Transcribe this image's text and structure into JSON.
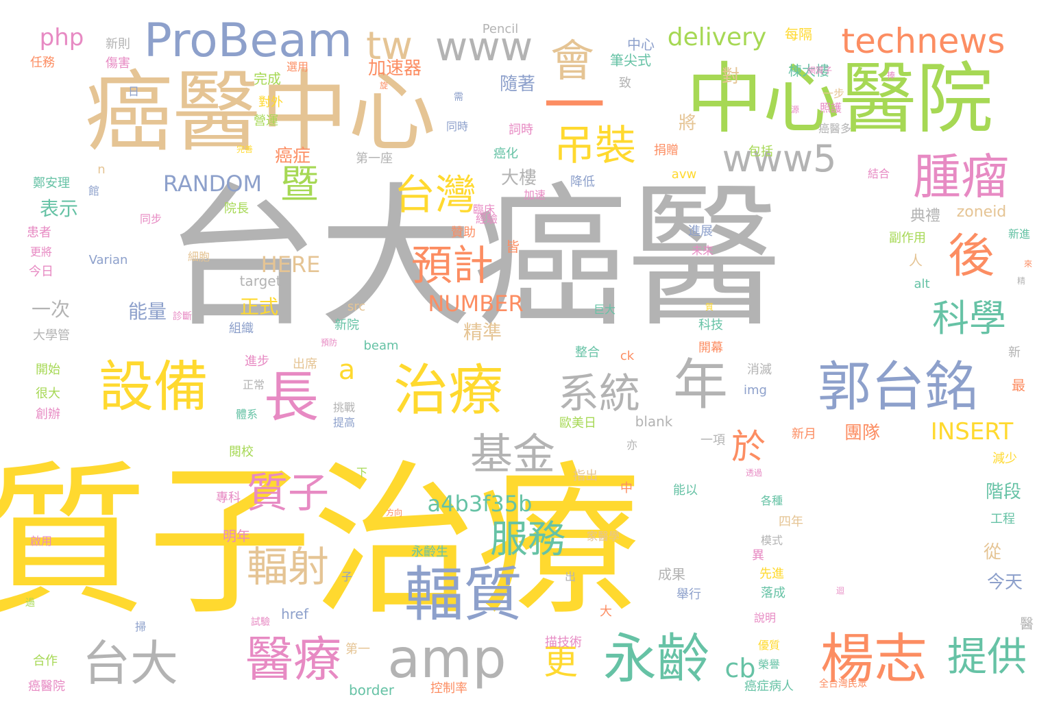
{
  "palette": {
    "gray": "#b3b3b3",
    "yellow": "#ffd92f",
    "tan": "#e5c494",
    "green": "#a6d854",
    "blue": "#8da0cb",
    "pink": "#e78ac3",
    "orange": "#fc8d62",
    "teal": "#66c2a5"
  },
  "words": [
    {
      "text": "質子治療",
      "color": "yellow"
    },
    {
      "text": "台大癌醫",
      "color": "gray"
    },
    {
      "text": "癌醫中心",
      "color": "tan"
    },
    {
      "text": "中心醫院",
      "color": "green"
    },
    {
      "text": "一",
      "color": "orange"
    },
    {
      "text": "ProBeam",
      "color": "blue"
    },
    {
      "text": "tw",
      "color": "tan"
    },
    {
      "text": "www",
      "color": "gray"
    },
    {
      "text": "會",
      "color": "tan"
    },
    {
      "text": "technews",
      "color": "orange"
    },
    {
      "text": "php",
      "color": "pink"
    },
    {
      "text": "delivery",
      "color": "green"
    },
    {
      "text": "吊裝",
      "color": "yellow"
    },
    {
      "text": "www5",
      "color": "gray"
    },
    {
      "text": "腫瘤",
      "color": "pink"
    },
    {
      "text": "台灣",
      "color": "yellow"
    },
    {
      "text": "暨",
      "color": "green"
    },
    {
      "text": "後",
      "color": "orange"
    },
    {
      "text": "預計",
      "color": "orange"
    },
    {
      "text": "科學",
      "color": "teal"
    },
    {
      "text": "設備",
      "color": "yellow"
    },
    {
      "text": "治療",
      "color": "yellow"
    },
    {
      "text": "長",
      "color": "pink"
    },
    {
      "text": "系統",
      "color": "gray"
    },
    {
      "text": "年",
      "color": "gray"
    },
    {
      "text": "郭台銘",
      "color": "blue"
    },
    {
      "text": "a",
      "color": "yellow"
    },
    {
      "text": "基金",
      "color": "gray"
    },
    {
      "text": "於",
      "color": "orange"
    },
    {
      "text": "質子",
      "color": "pink"
    },
    {
      "text": "輻射",
      "color": "tan"
    },
    {
      "text": "服務",
      "color": "teal"
    },
    {
      "text": "輻質",
      "color": "blue"
    },
    {
      "text": "a4b3f35b",
      "color": "teal"
    },
    {
      "text": "INSERT",
      "color": "yellow"
    },
    {
      "text": "台大",
      "color": "gray"
    },
    {
      "text": "醫療",
      "color": "pink"
    },
    {
      "text": "amp",
      "color": "gray"
    },
    {
      "text": "更",
      "color": "yellow"
    },
    {
      "text": "永齡",
      "color": "teal"
    },
    {
      "text": "楊志",
      "color": "orange"
    },
    {
      "text": "提供",
      "color": "teal"
    },
    {
      "text": "cb",
      "color": "teal"
    },
    {
      "text": "RANDOM",
      "color": "blue"
    },
    {
      "text": "HERE",
      "color": "tan"
    },
    {
      "text": "NUMBER",
      "color": "orange"
    },
    {
      "text": "加速器",
      "color": "orange"
    },
    {
      "text": "隨著",
      "color": "blue"
    },
    {
      "text": "大樓",
      "color": "gray"
    },
    {
      "text": "癌症",
      "color": "orange"
    },
    {
      "text": "將",
      "color": "tan"
    },
    {
      "text": "對",
      "color": "tan"
    },
    {
      "text": "表示",
      "color": "teal"
    },
    {
      "text": "一次",
      "color": "gray"
    },
    {
      "text": "能量",
      "color": "blue"
    },
    {
      "text": "正式",
      "color": "yellow"
    },
    {
      "text": "精準",
      "color": "tan"
    },
    {
      "text": "團隊",
      "color": "orange"
    },
    {
      "text": "階段",
      "color": "teal"
    },
    {
      "text": "今天",
      "color": "blue"
    },
    {
      "text": "從",
      "color": "tan"
    },
    {
      "text": "zoneid",
      "color": "tan"
    },
    {
      "text": "典禮",
      "color": "gray"
    },
    {
      "text": "Pencil",
      "color": "gray"
    },
    {
      "text": "每隔",
      "color": "yellow"
    },
    {
      "text": "新則",
      "color": "gray"
    },
    {
      "text": "任務",
      "color": "orange"
    },
    {
      "text": "傷害",
      "color": "pink"
    },
    {
      "text": "完成",
      "color": "green"
    },
    {
      "text": "對外",
      "color": "yellow"
    },
    {
      "text": "營運",
      "color": "green"
    },
    {
      "text": "筆尖式",
      "color": "teal"
    },
    {
      "text": "中心",
      "color": "blue"
    },
    {
      "text": "棟大樓",
      "color": "teal"
    },
    {
      "text": "照護",
      "color": "pink"
    },
    {
      "text": "癌醫多",
      "color": "gray"
    },
    {
      "text": "包括",
      "color": "green"
    },
    {
      "text": "捐贈",
      "color": "orange"
    },
    {
      "text": "同時",
      "color": "blue"
    },
    {
      "text": "詞時",
      "color": "pink"
    },
    {
      "text": "癌化",
      "color": "teal"
    },
    {
      "text": "第一座",
      "color": "gray"
    },
    {
      "text": "鄭安理",
      "color": "teal"
    },
    {
      "text": "院長",
      "color": "green"
    },
    {
      "text": "同步",
      "color": "pink"
    },
    {
      "text": "患者",
      "color": "pink"
    },
    {
      "text": "更將",
      "color": "pink"
    },
    {
      "text": "今日",
      "color": "pink"
    },
    {
      "text": "Varian",
      "color": "blue"
    },
    {
      "text": "細胞",
      "color": "tan"
    },
    {
      "text": "target",
      "color": "gray"
    },
    {
      "text": "src",
      "color": "tan"
    },
    {
      "text": "大學管",
      "color": "gray"
    },
    {
      "text": "組織",
      "color": "blue"
    },
    {
      "text": "新院",
      "color": "teal"
    },
    {
      "text": "beam",
      "color": "teal"
    },
    {
      "text": "開始",
      "color": "green"
    },
    {
      "text": "很大",
      "color": "green"
    },
    {
      "text": "創辦",
      "color": "pink"
    },
    {
      "text": "進步",
      "color": "pink"
    },
    {
      "text": "出席",
      "color": "tan"
    },
    {
      "text": "正常",
      "color": "gray"
    },
    {
      "text": "挑戰",
      "color": "gray"
    },
    {
      "text": "提高",
      "color": "blue"
    },
    {
      "text": "體系",
      "color": "teal"
    },
    {
      "text": "閱校",
      "color": "green"
    },
    {
      "text": "整合",
      "color": "teal"
    },
    {
      "text": "ck",
      "color": "orange"
    },
    {
      "text": "科技",
      "color": "teal"
    },
    {
      "text": "開幕",
      "color": "orange"
    },
    {
      "text": "消滅",
      "color": "gray"
    },
    {
      "text": "img",
      "color": "blue"
    },
    {
      "text": "blank",
      "color": "gray"
    },
    {
      "text": "歐美日",
      "color": "green"
    },
    {
      "text": "一項",
      "color": "gray"
    },
    {
      "text": "新月",
      "color": "orange"
    },
    {
      "text": "專科",
      "color": "pink"
    },
    {
      "text": "明年",
      "color": "pink"
    },
    {
      "text": "永齡生",
      "color": "teal"
    },
    {
      "text": "指出",
      "color": "tan"
    },
    {
      "text": "能以",
      "color": "teal"
    },
    {
      "text": "四年",
      "color": "tan"
    },
    {
      "text": "家醫學",
      "color": "tan"
    },
    {
      "text": "模式",
      "color": "gray"
    },
    {
      "text": "工程",
      "color": "teal"
    },
    {
      "text": "成果",
      "color": "gray"
    },
    {
      "text": "先進",
      "color": "yellow"
    },
    {
      "text": "落成",
      "color": "teal"
    },
    {
      "text": "舉行",
      "color": "blue"
    },
    {
      "text": "啟用",
      "color": "pink"
    },
    {
      "text": "href",
      "color": "blue"
    },
    {
      "text": "說明",
      "color": "pink"
    },
    {
      "text": "描技術",
      "color": "pink"
    },
    {
      "text": "第一",
      "color": "tan"
    },
    {
      "text": "合作",
      "color": "green"
    },
    {
      "text": "榮譽",
      "color": "teal"
    },
    {
      "text": "優質",
      "color": "yellow"
    },
    {
      "text": "癌醫院",
      "color": "pink"
    },
    {
      "text": "border",
      "color": "teal"
    },
    {
      "text": "控制率",
      "color": "orange"
    },
    {
      "text": "癌症病人",
      "color": "teal"
    },
    {
      "text": "全台灣民眾",
      "color": "orange"
    },
    {
      "text": "減少",
      "color": "yellow"
    },
    {
      "text": "副作用",
      "color": "green"
    },
    {
      "text": "新進",
      "color": "teal"
    },
    {
      "text": "alt",
      "color": "teal"
    },
    {
      "text": "avw",
      "color": "yellow"
    },
    {
      "text": "進展",
      "color": "blue"
    },
    {
      "text": "未來",
      "color": "pink"
    },
    {
      "text": "降低",
      "color": "blue"
    },
    {
      "text": "加速",
      "color": "pink"
    },
    {
      "text": "臨床",
      "color": "pink"
    },
    {
      "text": "經驗",
      "color": "pink"
    },
    {
      "text": "贊助",
      "color": "orange"
    },
    {
      "text": "皆",
      "color": "orange"
    },
    {
      "text": "人",
      "color": "tan"
    },
    {
      "text": "巨大",
      "color": "teal"
    },
    {
      "text": "診斷",
      "color": "pink"
    },
    {
      "text": "最",
      "color": "orange"
    },
    {
      "text": "新",
      "color": "gray"
    },
    {
      "text": "醫",
      "color": "gray"
    },
    {
      "text": "中",
      "color": "orange"
    },
    {
      "text": "大",
      "color": "orange"
    },
    {
      "text": "亦",
      "color": "gray"
    },
    {
      "text": "異",
      "color": "pink"
    },
    {
      "text": "致",
      "color": "gray"
    },
    {
      "text": "結合",
      "color": "pink"
    },
    {
      "text": "館",
      "color": "blue"
    },
    {
      "text": "n",
      "color": "tan"
    },
    {
      "text": "下",
      "color": "green"
    },
    {
      "text": "出",
      "color": "gray"
    },
    {
      "text": "子",
      "color": "blue"
    },
    {
      "text": "日",
      "color": "blue"
    },
    {
      "text": "一步",
      "color": "tan"
    },
    {
      "text": "網質子",
      "color": "pink"
    },
    {
      "text": "選用",
      "color": "orange"
    },
    {
      "text": "各種",
      "color": "teal"
    },
    {
      "text": "需",
      "color": "blue"
    },
    {
      "text": "過",
      "color": "green"
    },
    {
      "text": "掃",
      "color": "blue"
    },
    {
      "text": "試驗",
      "color": "pink"
    },
    {
      "text": "方向",
      "color": "orange"
    },
    {
      "text": "預防",
      "color": "pink"
    },
    {
      "text": "捧",
      "color": "pink"
    },
    {
      "text": "迴",
      "color": "pink"
    },
    {
      "text": "來",
      "color": "orange"
    },
    {
      "text": "精",
      "color": "gray"
    },
    {
      "text": "完善",
      "color": "yellow"
    },
    {
      "text": "旋",
      "color": "orange"
    },
    {
      "text": "透過",
      "color": "pink"
    },
    {
      "text": "質",
      "color": "yellow"
    },
    {
      "text": "源",
      "color": "pink"
    }
  ]
}
